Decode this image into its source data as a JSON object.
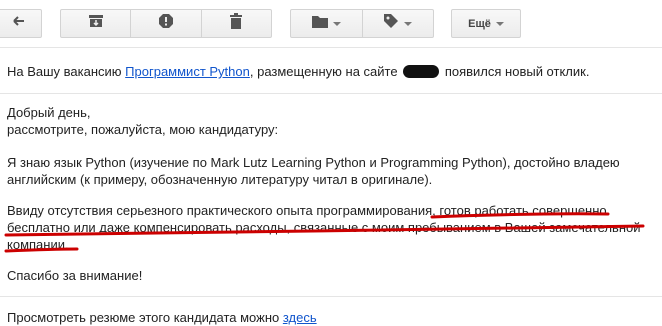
{
  "toolbar": {
    "more_label": "Ещё",
    "icons": [
      "back-arrow-icon",
      "archive-icon",
      "report-spam-icon",
      "trash-icon",
      "folder-icon",
      "label-tag-icon"
    ]
  },
  "email": {
    "intro_prefix": "На Вашу вакансию ",
    "vacancy_link": "Программист Python",
    "intro_middle": ", размещенную на сайте",
    "intro_suffix": " появился новый отклик.",
    "greeting": "Добрый день,",
    "request": "рассмотрите, пожалуйста, мою кандидатуру:",
    "skills_line1": "Я знаю язык Python (изучение по Mark Lutz Learning Python и Programming Python), достойно владею",
    "skills_line2": "английским (к примеру, обозначенную литературу читал в оригинале).",
    "offer_line1_prefix": "Ввиду отсутствия серьезного практического опыта программирования, ",
    "offer_line1_highlight": "готов работать совершенно",
    "offer_line2": "бесплатно или даже компенсировать расходы, связанные с моим пребыванием в Вашей замечательной",
    "offer_line3": "компании.",
    "thanks": "Спасибо за внимание!",
    "resume_prefix": "Просмотреть резюме этого кандидата можно ",
    "resume_link": "здесь"
  },
  "colors": {
    "link": "#1155cc",
    "annotation": "#cc0000"
  }
}
